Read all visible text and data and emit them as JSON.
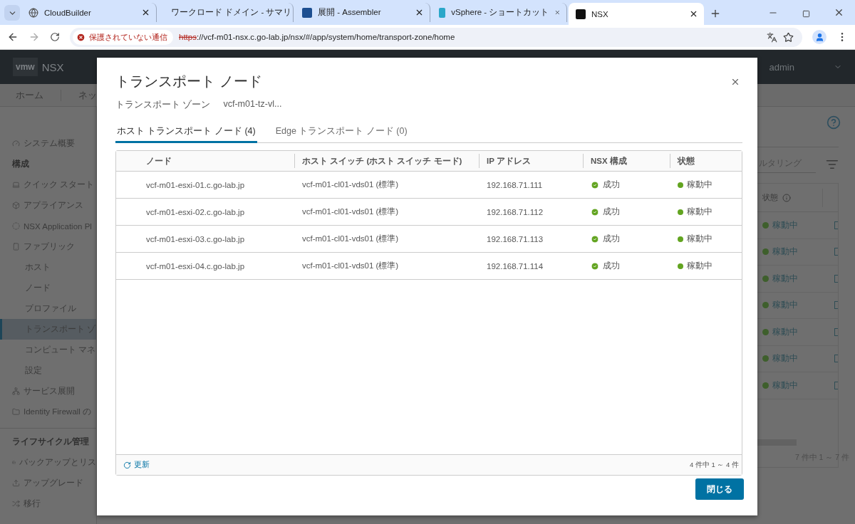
{
  "browser": {
    "tabs": [
      {
        "title": "CloudBuilder",
        "selected": false
      },
      {
        "title": "ワークロード ドメイン - サマリ",
        "selected": false
      },
      {
        "title": "展開 - Assembler",
        "selected": false
      },
      {
        "title": "vSphere - ショートカット",
        "selected": false
      },
      {
        "title": "NSX",
        "selected": true
      }
    ],
    "security_label": "保護されていない通信",
    "url_scheme": "https",
    "url_rest": "://vcf-m01-nsx.c.go-lab.jp/nsx/#/app/system/home/transport-zone/home"
  },
  "app": {
    "logo": "vmw",
    "product": "NSX",
    "user": "admin",
    "nav": [
      "ホーム",
      "ネッ"
    ],
    "sidebar_groups": [
      {
        "items": [
          {
            "kind": "item",
            "label": "システム概要",
            "selected": false
          },
          {
            "kind": "section",
            "label": "構成"
          },
          {
            "kind": "item",
            "label": "クイック スタート",
            "selected": false
          },
          {
            "kind": "item",
            "label": "アプライアンス",
            "selected": false
          },
          {
            "kind": "item",
            "label": "NSX Application Pl",
            "selected": false
          },
          {
            "kind": "item",
            "label": "ファブリック",
            "selected": false
          },
          {
            "kind": "subitem",
            "label": "ホスト",
            "selected": false
          },
          {
            "kind": "subitem",
            "label": "ノード",
            "selected": false
          },
          {
            "kind": "subitem",
            "label": "プロファイル",
            "selected": false
          },
          {
            "kind": "subitem",
            "label": "トランスポート ゾ",
            "selected": true
          },
          {
            "kind": "subitem",
            "label": "コンピュート マネ",
            "selected": false
          },
          {
            "kind": "subitem",
            "label": "設定",
            "selected": false
          },
          {
            "kind": "item",
            "label": "サービス展開",
            "selected": false
          },
          {
            "kind": "item",
            "label": "Identity Firewall の",
            "selected": false
          }
        ]
      },
      {
        "items": [
          {
            "kind": "section",
            "label": "ライフサイクル管理"
          },
          {
            "kind": "item",
            "label": "バックアップとリス",
            "selected": false
          },
          {
            "kind": "item",
            "label": "アップグレード",
            "selected": false
          },
          {
            "kind": "item",
            "label": "移行",
            "selected": false
          }
        ]
      }
    ],
    "filter_placeholder": "ルタリング",
    "status_column": "状態",
    "status_rows": [
      "稼動中",
      "稼動中",
      "稼動中",
      "稼動中",
      "稼動中",
      "稼動中",
      "稼動中"
    ],
    "pagination": "7 件中 1 ～ 7 件"
  },
  "modal": {
    "title": "トランスポート ノード",
    "zone_label": "トランスポート ゾーン",
    "zone_value": "vcf-m01-tz-vl...",
    "tabs": [
      {
        "label": "ホスト トランスポート ノード (4)",
        "selected": true
      },
      {
        "label": "Edge トランスポート ノード (0)",
        "selected": false
      }
    ],
    "columns": [
      "ノード",
      "ホスト スイッチ (ホスト スイッチ モード)",
      "IP アドレス",
      "NSX 構成",
      "状態"
    ],
    "rows": [
      {
        "node": "vcf-m01-esxi-01.c.go-lab.jp",
        "switch": "vcf-m01-cl01-vds01 (標準)",
        "ip": "192.168.71.111",
        "config": "成功",
        "status": "稼動中"
      },
      {
        "node": "vcf-m01-esxi-02.c.go-lab.jp",
        "switch": "vcf-m01-cl01-vds01 (標準)",
        "ip": "192.168.71.112",
        "config": "成功",
        "status": "稼動中"
      },
      {
        "node": "vcf-m01-esxi-03.c.go-lab.jp",
        "switch": "vcf-m01-cl01-vds01 (標準)",
        "ip": "192.168.71.113",
        "config": "成功",
        "status": "稼動中"
      },
      {
        "node": "vcf-m01-esxi-04.c.go-lab.jp",
        "switch": "vcf-m01-cl01-vds01 (標準)",
        "ip": "192.168.71.114",
        "config": "成功",
        "status": "稼動中"
      }
    ],
    "refresh": "更新",
    "count": "4 件中 1 ～ 4 件",
    "close_button": "閉じる"
  }
}
